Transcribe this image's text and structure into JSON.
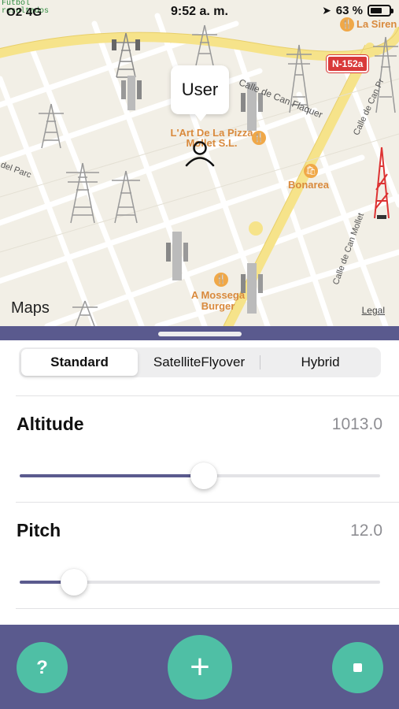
{
  "status_bar": {
    "carrier": "O2  4G",
    "time": "9:52 a. m.",
    "battery": "63 %",
    "battery_level": 0.63,
    "overlay_text_1": "Futbol",
    "overlay_text_2": "resultados"
  },
  "map": {
    "callout_label": "User",
    "road_badge": "N-152a",
    "pois": [
      {
        "name": "La Siren",
        "icon": "food-icon"
      },
      {
        "name": "L'Art De La Pizza Mollet S.L.",
        "icon": "food-icon"
      },
      {
        "name": "Bonarea",
        "icon": "shopping-icon"
      },
      {
        "name": "A Mossega Burger",
        "icon": "food-icon"
      }
    ],
    "street_labels": [
      "Calle de Can Flaquer",
      "Calle de Can Pr",
      "Calle de Can Mollet",
      "del Parc"
    ],
    "brand": "Maps",
    "legal": "Legal"
  },
  "map_type": {
    "options": [
      "Standard",
      "SatelliteFlyover",
      "Hybrid"
    ],
    "selected": "Standard"
  },
  "settings": {
    "altitude": {
      "label": "Altitude",
      "value": "1013.0",
      "slider_fraction": 0.51
    },
    "pitch": {
      "label": "Pitch",
      "value": "12.0",
      "slider_fraction": 0.15
    }
  },
  "actions": {
    "help_label": "?",
    "add_label": "+",
    "stop_icon": "stop-icon"
  },
  "colors": {
    "accent": "#5a5a8e",
    "fab": "#4fbfa5",
    "poi": "#d98a3d",
    "road_badge": "#d93a3a"
  }
}
